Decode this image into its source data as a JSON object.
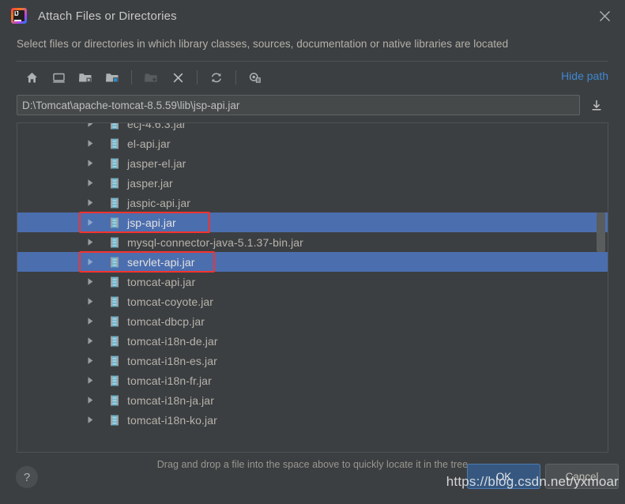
{
  "window": {
    "title": "Attach Files or Directories",
    "logo_icon": "intellij-idea-logo",
    "close_icon": "close-icon"
  },
  "subtitle": "Select files or directories in which library classes, sources, documentation or native libraries are located",
  "toolbar": {
    "buttons": [
      {
        "icon": "home-icon",
        "name": "home-button",
        "disabled": false
      },
      {
        "icon": "desktop-icon",
        "name": "desktop-button",
        "disabled": false
      },
      {
        "icon": "project-folder-icon",
        "name": "project-folder-button",
        "disabled": false
      },
      {
        "icon": "module-folder-icon",
        "name": "module-folder-button",
        "disabled": false
      },
      {
        "icon": "new-folder-icon",
        "name": "new-folder-button",
        "disabled": true
      },
      {
        "icon": "delete-x-icon",
        "name": "delete-button",
        "disabled": false
      },
      {
        "icon": "refresh-icon",
        "name": "refresh-button",
        "disabled": false
      },
      {
        "icon": "show-hidden-icon",
        "name": "show-hidden-button",
        "disabled": false
      }
    ],
    "hide_path_label": "Hide path",
    "hide_path_color": "#3f87d2"
  },
  "path_field": {
    "value": "D:\\Tomcat\\apache-tomcat-8.5.59\\lib\\jsp-api.jar",
    "placeholder": "",
    "download_icon": "download-icon"
  },
  "tree": {
    "expand_arrow_icon": "chevron-right-icon",
    "file_icon": "jar-file-icon",
    "rows": [
      {
        "label": "ecj-4.6.3.jar",
        "selected": false,
        "annotated": false
      },
      {
        "label": "el-api.jar",
        "selected": false,
        "annotated": false
      },
      {
        "label": "jasper-el.jar",
        "selected": false,
        "annotated": false
      },
      {
        "label": "jasper.jar",
        "selected": false,
        "annotated": false
      },
      {
        "label": "jaspic-api.jar",
        "selected": false,
        "annotated": false
      },
      {
        "label": "jsp-api.jar",
        "selected": true,
        "annotated": true
      },
      {
        "label": "mysql-connector-java-5.1.37-bin.jar",
        "selected": false,
        "annotated": false
      },
      {
        "label": "servlet-api.jar",
        "selected": true,
        "annotated": true
      },
      {
        "label": "tomcat-api.jar",
        "selected": false,
        "annotated": false
      },
      {
        "label": "tomcat-coyote.jar",
        "selected": false,
        "annotated": false
      },
      {
        "label": "tomcat-dbcp.jar",
        "selected": false,
        "annotated": false
      },
      {
        "label": "tomcat-i18n-de.jar",
        "selected": false,
        "annotated": false
      },
      {
        "label": "tomcat-i18n-es.jar",
        "selected": false,
        "annotated": false
      },
      {
        "label": "tomcat-i18n-fr.jar",
        "selected": false,
        "annotated": false
      },
      {
        "label": "tomcat-i18n-ja.jar",
        "selected": false,
        "annotated": false
      },
      {
        "label": "tomcat-i18n-ko.jar",
        "selected": false,
        "annotated": false
      },
      {
        "label": "",
        "selected": false,
        "annotated": false
      }
    ],
    "selection_color": "#4b6eaf",
    "annotation_color": "#f4332f"
  },
  "hint": "Drag and drop a file into the space above to quickly locate it in the tree",
  "footer": {
    "help_label": "?",
    "ok_label": "OK",
    "cancel_label": "Cancel",
    "ok_color": "#365880"
  },
  "watermark": "https://blog.csdn.net/yxmoar"
}
